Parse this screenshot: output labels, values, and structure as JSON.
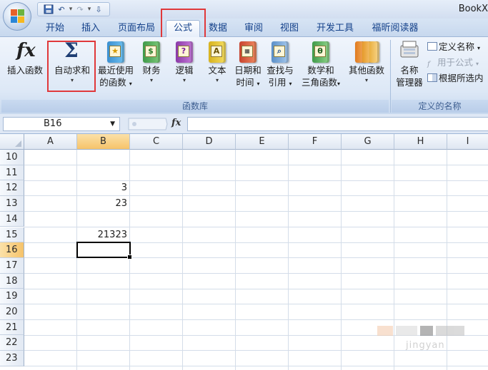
{
  "window": {
    "title": "BookX"
  },
  "quick_access": {
    "undo": "↶",
    "redo": "↷",
    "customize": "⇩"
  },
  "tabs": [
    {
      "label": "开始"
    },
    {
      "label": "插入"
    },
    {
      "label": "页面布局"
    },
    {
      "label": "公式",
      "active": true
    },
    {
      "label": "数据"
    },
    {
      "label": "审阅"
    },
    {
      "label": "视图"
    },
    {
      "label": "开发工具"
    },
    {
      "label": "福昕阅读器"
    }
  ],
  "ribbon": {
    "function_library": {
      "label": "函数库",
      "insert_function": {
        "line1": "插入函数",
        "icon": "fx-icon"
      },
      "autosum": {
        "line1": "自动求和",
        "icon": "sigma-icon",
        "symbol": "Σ"
      },
      "recent": {
        "line1": "最近使用",
        "line2": "的函数"
      },
      "financial": {
        "line1": "财务"
      },
      "logical": {
        "line1": "逻辑"
      },
      "text": {
        "line1": "文本"
      },
      "datetime": {
        "line1": "日期和",
        "line2": "时间"
      },
      "lookup": {
        "line1": "查找与",
        "line2": "引用"
      },
      "math": {
        "line1": "数学和",
        "line2": "三角函数"
      },
      "more": {
        "line1": "其他函数"
      }
    },
    "defined_names": {
      "label": "定义的名称",
      "name_manager": {
        "line1": "名称",
        "line2": "管理器"
      },
      "define_name": "定义名称",
      "use_in_formula": "用于公式",
      "create_from_selection": "根据所选内"
    }
  },
  "formula_bar": {
    "name_box": "B16",
    "fx_label": "fx",
    "formula": ""
  },
  "columns": [
    "A",
    "B",
    "C",
    "D",
    "E",
    "F",
    "G",
    "H",
    "I"
  ],
  "rows": [
    "10",
    "11",
    "12",
    "13",
    "14",
    "15",
    "16",
    "17",
    "18",
    "19",
    "20",
    "21",
    "22",
    "23"
  ],
  "cells": {
    "B12": "3",
    "B13": "23",
    "B15": "21323"
  },
  "selection": {
    "cell": "B16",
    "column": "B",
    "row": "16"
  },
  "watermark_text": "jingyan"
}
